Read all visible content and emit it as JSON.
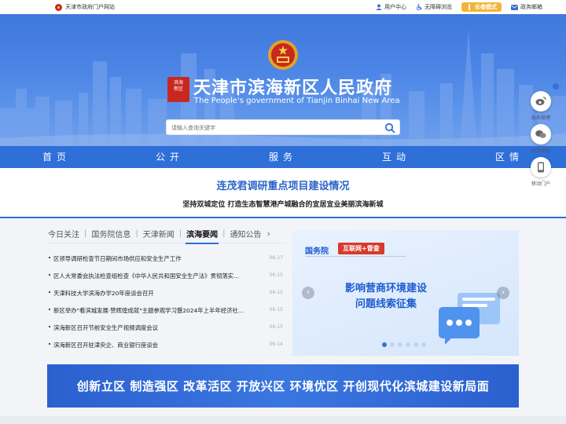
{
  "topbar": {
    "portal_link": "天津市政府门户网站",
    "user_center": "用户中心",
    "accessibility": "无障碍浏览",
    "elder_mode": "长者模式",
    "mailbox": "政务邮箱"
  },
  "header": {
    "title": "天津市滨海新区人民政府",
    "subtitle": "The People's government of Tianjin Binhai New Area"
  },
  "search": {
    "placeholder": "请输入查询关键字"
  },
  "nav": {
    "items": [
      "首页",
      "公开",
      "服务",
      "互动",
      "区情"
    ]
  },
  "headline": {
    "title": "连茂君调研重点项目建设情况",
    "subtitle": "坚持双城定位 打造生态智慧港产城融合的宜居宜业美丽滨海新城"
  },
  "float_bar": {
    "items": [
      "政务微博",
      "政务微信",
      "移动门户"
    ]
  },
  "news": {
    "tabs": [
      "今日关注",
      "国务院信息",
      "天津新闻",
      "滨海要闻",
      "通知公告"
    ],
    "active_tab": "滨海要闻",
    "items": [
      {
        "title": "区领导调研检查节日期间市场供应和安全生产工作",
        "date": "06-17"
      },
      {
        "title": "区人大常委会执法检查组检查《中华人民共和国安全生产法》贯彻落实...",
        "date": "06-15"
      },
      {
        "title": "天津科技大学滨海办学20年座谈会召开",
        "date": "06-15"
      },
      {
        "title": "新区举办\"看滨城发展·赞辉煌成就\"主题参观学习暨2024年上半年经济社...",
        "date": "06-15"
      },
      {
        "title": "滨海新区召开节前安全生产视频调度会议",
        "date": "06-15"
      },
      {
        "title": "滨海新区召开驻津央企、商业银行座谈会",
        "date": "06-14"
      }
    ]
  },
  "carousel": {
    "label": "国务院",
    "tag": "互联网+督查",
    "line1": "影响营商环境建设",
    "line2": "问题线索征集",
    "dot_count": 6,
    "active_dot": 0
  },
  "slogan": {
    "text": "创新立区 制造强区 改革活区 开放兴区 环境优区 开创现代化滨城建设新局面"
  },
  "colors": {
    "primary": "#2e6fd8",
    "banner": "#4d86e6",
    "accent_red": "#d73a2c",
    "elder_yellow": "#f2b53a"
  }
}
